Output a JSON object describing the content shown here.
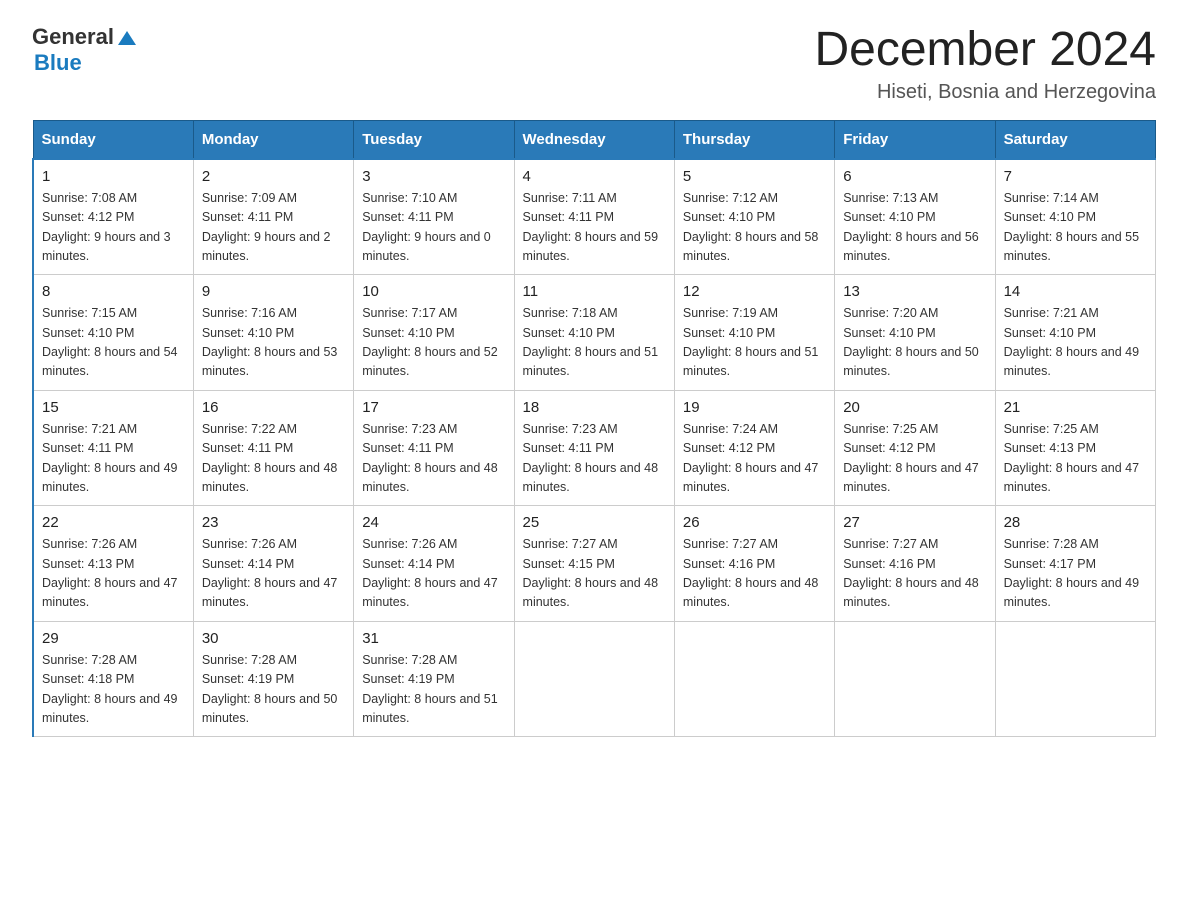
{
  "header": {
    "logo_general": "General",
    "logo_blue": "Blue",
    "title": "December 2024",
    "subtitle": "Hiseti, Bosnia and Herzegovina"
  },
  "calendar": {
    "headers": [
      "Sunday",
      "Monday",
      "Tuesday",
      "Wednesday",
      "Thursday",
      "Friday",
      "Saturday"
    ],
    "weeks": [
      [
        {
          "day": "1",
          "sunrise": "7:08 AM",
          "sunset": "4:12 PM",
          "daylight": "9 hours and 3 minutes."
        },
        {
          "day": "2",
          "sunrise": "7:09 AM",
          "sunset": "4:11 PM",
          "daylight": "9 hours and 2 minutes."
        },
        {
          "day": "3",
          "sunrise": "7:10 AM",
          "sunset": "4:11 PM",
          "daylight": "9 hours and 0 minutes."
        },
        {
          "day": "4",
          "sunrise": "7:11 AM",
          "sunset": "4:11 PM",
          "daylight": "8 hours and 59 minutes."
        },
        {
          "day": "5",
          "sunrise": "7:12 AM",
          "sunset": "4:10 PM",
          "daylight": "8 hours and 58 minutes."
        },
        {
          "day": "6",
          "sunrise": "7:13 AM",
          "sunset": "4:10 PM",
          "daylight": "8 hours and 56 minutes."
        },
        {
          "day": "7",
          "sunrise": "7:14 AM",
          "sunset": "4:10 PM",
          "daylight": "8 hours and 55 minutes."
        }
      ],
      [
        {
          "day": "8",
          "sunrise": "7:15 AM",
          "sunset": "4:10 PM",
          "daylight": "8 hours and 54 minutes."
        },
        {
          "day": "9",
          "sunrise": "7:16 AM",
          "sunset": "4:10 PM",
          "daylight": "8 hours and 53 minutes."
        },
        {
          "day": "10",
          "sunrise": "7:17 AM",
          "sunset": "4:10 PM",
          "daylight": "8 hours and 52 minutes."
        },
        {
          "day": "11",
          "sunrise": "7:18 AM",
          "sunset": "4:10 PM",
          "daylight": "8 hours and 51 minutes."
        },
        {
          "day": "12",
          "sunrise": "7:19 AM",
          "sunset": "4:10 PM",
          "daylight": "8 hours and 51 minutes."
        },
        {
          "day": "13",
          "sunrise": "7:20 AM",
          "sunset": "4:10 PM",
          "daylight": "8 hours and 50 minutes."
        },
        {
          "day": "14",
          "sunrise": "7:21 AM",
          "sunset": "4:10 PM",
          "daylight": "8 hours and 49 minutes."
        }
      ],
      [
        {
          "day": "15",
          "sunrise": "7:21 AM",
          "sunset": "4:11 PM",
          "daylight": "8 hours and 49 minutes."
        },
        {
          "day": "16",
          "sunrise": "7:22 AM",
          "sunset": "4:11 PM",
          "daylight": "8 hours and 48 minutes."
        },
        {
          "day": "17",
          "sunrise": "7:23 AM",
          "sunset": "4:11 PM",
          "daylight": "8 hours and 48 minutes."
        },
        {
          "day": "18",
          "sunrise": "7:23 AM",
          "sunset": "4:11 PM",
          "daylight": "8 hours and 48 minutes."
        },
        {
          "day": "19",
          "sunrise": "7:24 AM",
          "sunset": "4:12 PM",
          "daylight": "8 hours and 47 minutes."
        },
        {
          "day": "20",
          "sunrise": "7:25 AM",
          "sunset": "4:12 PM",
          "daylight": "8 hours and 47 minutes."
        },
        {
          "day": "21",
          "sunrise": "7:25 AM",
          "sunset": "4:13 PM",
          "daylight": "8 hours and 47 minutes."
        }
      ],
      [
        {
          "day": "22",
          "sunrise": "7:26 AM",
          "sunset": "4:13 PM",
          "daylight": "8 hours and 47 minutes."
        },
        {
          "day": "23",
          "sunrise": "7:26 AM",
          "sunset": "4:14 PM",
          "daylight": "8 hours and 47 minutes."
        },
        {
          "day": "24",
          "sunrise": "7:26 AM",
          "sunset": "4:14 PM",
          "daylight": "8 hours and 47 minutes."
        },
        {
          "day": "25",
          "sunrise": "7:27 AM",
          "sunset": "4:15 PM",
          "daylight": "8 hours and 48 minutes."
        },
        {
          "day": "26",
          "sunrise": "7:27 AM",
          "sunset": "4:16 PM",
          "daylight": "8 hours and 48 minutes."
        },
        {
          "day": "27",
          "sunrise": "7:27 AM",
          "sunset": "4:16 PM",
          "daylight": "8 hours and 48 minutes."
        },
        {
          "day": "28",
          "sunrise": "7:28 AM",
          "sunset": "4:17 PM",
          "daylight": "8 hours and 49 minutes."
        }
      ],
      [
        {
          "day": "29",
          "sunrise": "7:28 AM",
          "sunset": "4:18 PM",
          "daylight": "8 hours and 49 minutes."
        },
        {
          "day": "30",
          "sunrise": "7:28 AM",
          "sunset": "4:19 PM",
          "daylight": "8 hours and 50 minutes."
        },
        {
          "day": "31",
          "sunrise": "7:28 AM",
          "sunset": "4:19 PM",
          "daylight": "8 hours and 51 minutes."
        },
        null,
        null,
        null,
        null
      ]
    ],
    "labels": {
      "sunrise": "Sunrise:",
      "sunset": "Sunset:",
      "daylight": "Daylight:"
    }
  }
}
